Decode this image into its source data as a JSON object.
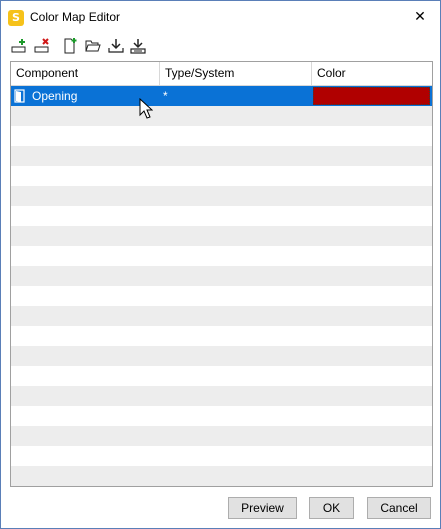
{
  "window": {
    "title": "Color Map Editor",
    "app_icon_letter": "S",
    "close_glyph": "✕"
  },
  "toolbar": {
    "buttons": [
      {
        "name": "add-row-icon"
      },
      {
        "name": "remove-row-icon"
      },
      {
        "name": "new-file-icon"
      },
      {
        "name": "open-folder-icon"
      },
      {
        "name": "import-icon"
      },
      {
        "name": "export-icon"
      }
    ]
  },
  "grid": {
    "columns": [
      "Component",
      "Type/System",
      "Color"
    ],
    "rows": [
      {
        "component": "Opening",
        "type_system": "*",
        "color": "#b00000",
        "selected": true
      }
    ]
  },
  "footer": {
    "preview_label": "Preview",
    "ok_label": "OK",
    "cancel_label": "Cancel"
  },
  "colors": {
    "selection": "#0a72d6",
    "swatch": "#b00000",
    "row_alt": "#ededed"
  }
}
